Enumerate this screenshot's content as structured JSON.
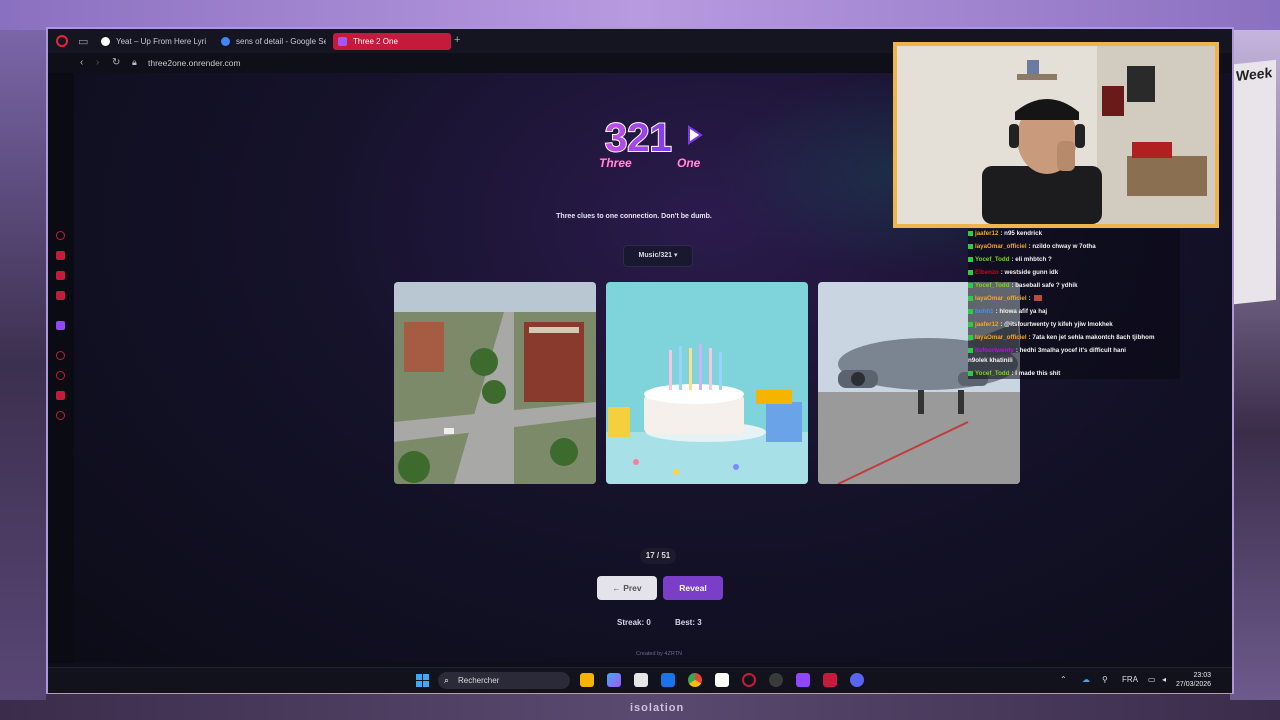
{
  "browser": {
    "tabs": [
      {
        "label": "Yeat – Up From Here Lyrics",
        "active": false,
        "favicon_color": "#ffffff"
      },
      {
        "label": "sens of detail - Google Se",
        "active": false,
        "favicon_color": "#4285f4"
      },
      {
        "label": "Three 2 One",
        "active": true,
        "favicon_color": "#a855f7"
      }
    ],
    "url": "three2one.onrender.com",
    "accent": "#c51a3b"
  },
  "app": {
    "logo": {
      "number": "321",
      "word_left": "Three",
      "word_right": "One"
    },
    "tagline": "Three clues to one connection. Don't be dumb.",
    "category_select": "Music/321",
    "cards": [
      {
        "alt": "aerial city street intersection"
      },
      {
        "alt": "birthday cake with candles"
      },
      {
        "alt": "U.S. Air Force cargo plane"
      }
    ],
    "counter": "17 / 51",
    "prev_label": "← Prev",
    "reveal_label": "Reveal",
    "streak": "Streak: 0",
    "best": "Best: 3",
    "credit": "Created by 4ZRTN",
    "colors": {
      "reveal": "#7a3ec8",
      "prev": "#e4e2ea"
    }
  },
  "taskbar": {
    "search_placeholder": "Rechercher",
    "lang": "FRA",
    "time": "23:03",
    "date": "27/03/2026"
  },
  "chat": [
    {
      "user": "jaafer12",
      "color": "#f5a623",
      "text": ": n95 kendrick"
    },
    {
      "user": "layaOmar_officiel",
      "color": "#f5a623",
      "text": ": nzildo chway w 7otha"
    },
    {
      "user": "Yocef_Todd",
      "color": "#7ed321",
      "text": ": eli mhbtch ?"
    },
    {
      "user": "Elbenzo",
      "color": "#d0021b",
      "text": ": westside gunn idk"
    },
    {
      "user": "Yocef_Todd",
      "color": "#7ed321",
      "text": ": baseball safe ? ydhik"
    },
    {
      "user": "layaOmar_officiel",
      "color": "#f5a623",
      "text": ":"
    },
    {
      "user": "bohh1",
      "color": "#4a90e2",
      "text": ": hlowa afif ya haj"
    },
    {
      "user": "jaafer12",
      "color": "#f5a623",
      "text": ": @itsfourtwenty ty kifeh yjiw lmokhek"
    },
    {
      "user": "layaOmar_officiel",
      "color": "#f5a623",
      "text": ": 7ata ken jet sehla makontch 8ach tjibhom"
    },
    {
      "user": "itsfourtwenty",
      "color": "#bd10e0",
      "text": ": hedhi 3malha yocef it's difficult hani"
    },
    {
      "user": "",
      "color": "#ffffff",
      "text": "n9olek khatinili"
    },
    {
      "user": "Yocef_Todd",
      "color": "#7ed321",
      "text": ": I made this shit"
    }
  ],
  "overlay": {
    "floor_text": "isolation"
  }
}
